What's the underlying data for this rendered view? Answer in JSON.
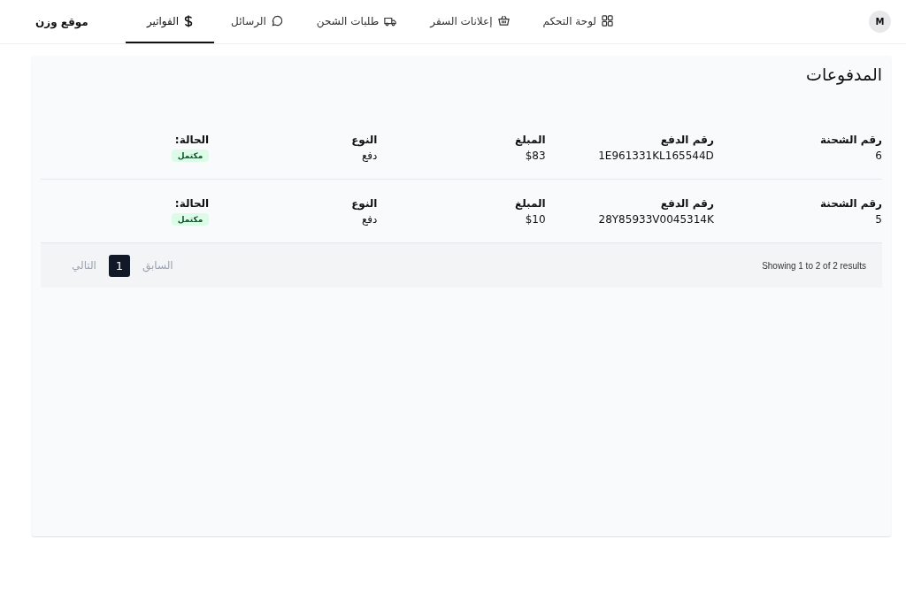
{
  "nav": {
    "avatar": "M",
    "items": [
      {
        "label": "لوحة التحكم",
        "kind": "grid",
        "selected": false
      },
      {
        "label": "إعلانات السفر",
        "kind": "basket",
        "selected": false
      },
      {
        "label": "طلبات الشحن",
        "kind": "truck",
        "selected": false
      },
      {
        "label": "الرسائل",
        "kind": "chat",
        "selected": false
      },
      {
        "label": "الفواتير",
        "kind": "dollar",
        "selected": true
      }
    ],
    "brand": "موقع وزن"
  },
  "page": {
    "title": "المدفوعات"
  },
  "payments": [
    {
      "fields": [
        {
          "kind": "text",
          "label": "رقم الشحنة",
          "value": "6"
        },
        {
          "kind": "text",
          "label": "رقم الدفع",
          "value": "1E961331KL165544D"
        },
        {
          "kind": "text",
          "label": "المبلغ",
          "value": "$83"
        },
        {
          "kind": "text",
          "label": "النوع",
          "value": "دفع"
        },
        {
          "kind": "badge",
          "label": "الحالة:",
          "value": "مكتمل",
          "color": "#dcfce7"
        }
      ]
    },
    {
      "fields": [
        {
          "kind": "text",
          "label": "رقم الشحنة",
          "value": "5"
        },
        {
          "kind": "text",
          "label": "رقم الدفع",
          "value": "28Y85933V0045314K"
        },
        {
          "kind": "text",
          "label": "المبلغ",
          "value": "$10"
        },
        {
          "kind": "text",
          "label": "النوع",
          "value": "دفع"
        },
        {
          "kind": "badge",
          "label": "الحالة:",
          "value": "مكتمل",
          "color": "#dcfce7"
        }
      ]
    }
  ],
  "pagination": {
    "summary": "Showing 1 to 2 of 2 results",
    "previous": {
      "label": "السابق",
      "disabled": true
    },
    "pages": [
      {
        "label": "1",
        "selected": true
      }
    ],
    "next": {
      "label": "التالي",
      "disabled": true
    }
  }
}
